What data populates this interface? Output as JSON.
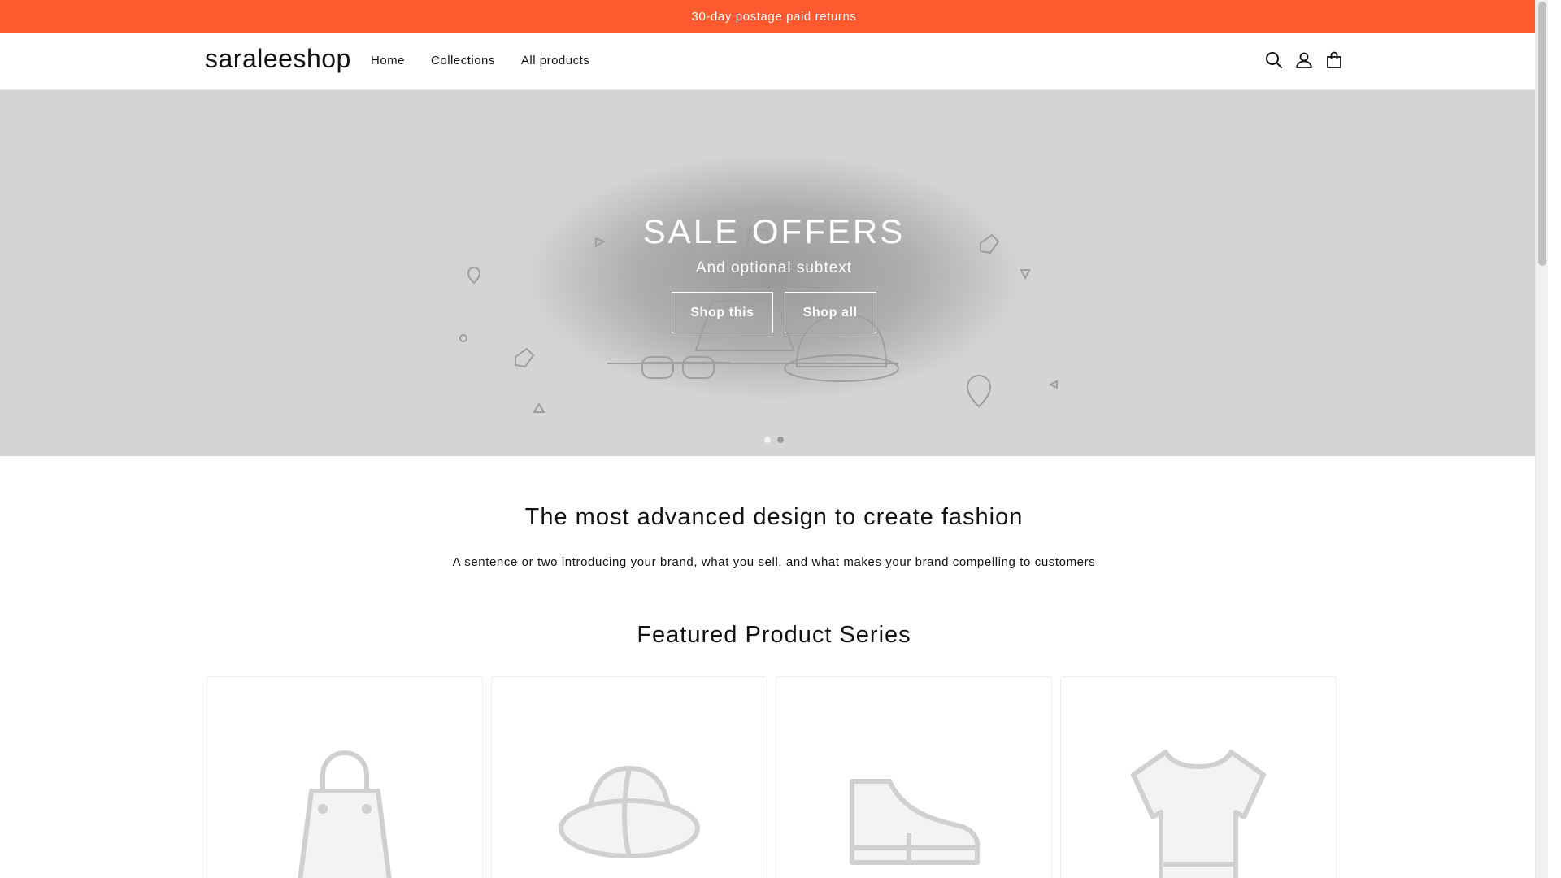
{
  "announcement": {
    "text": "30-day postage paid returns"
  },
  "header": {
    "logo": "saraleeshop",
    "nav": [
      {
        "label": "Home"
      },
      {
        "label": "Collections"
      },
      {
        "label": "All products"
      }
    ],
    "icons": [
      "search-icon",
      "account-icon",
      "cart-icon"
    ]
  },
  "hero": {
    "title": "SALE OFFERS",
    "subtitle": "And optional subtext",
    "buttons": [
      {
        "label": "Shop this"
      },
      {
        "label": "Shop all"
      }
    ],
    "slides": 2,
    "active_slide": 1
  },
  "intro": {
    "heading": "The most advanced design to create fashion",
    "text": "A sentence or two introducing your brand, what you sell, and what makes your brand compelling to customers"
  },
  "featured": {
    "title": "Featured Product Series",
    "cards": [
      {
        "icon": "handbag-icon"
      },
      {
        "icon": "hat-icon"
      },
      {
        "icon": "shoe-icon"
      },
      {
        "icon": "tshirt-icon"
      }
    ]
  },
  "colors": {
    "announcement_bg": "#ff5a2f",
    "hero_bg": "#d4d4d4",
    "text": "#121212"
  }
}
